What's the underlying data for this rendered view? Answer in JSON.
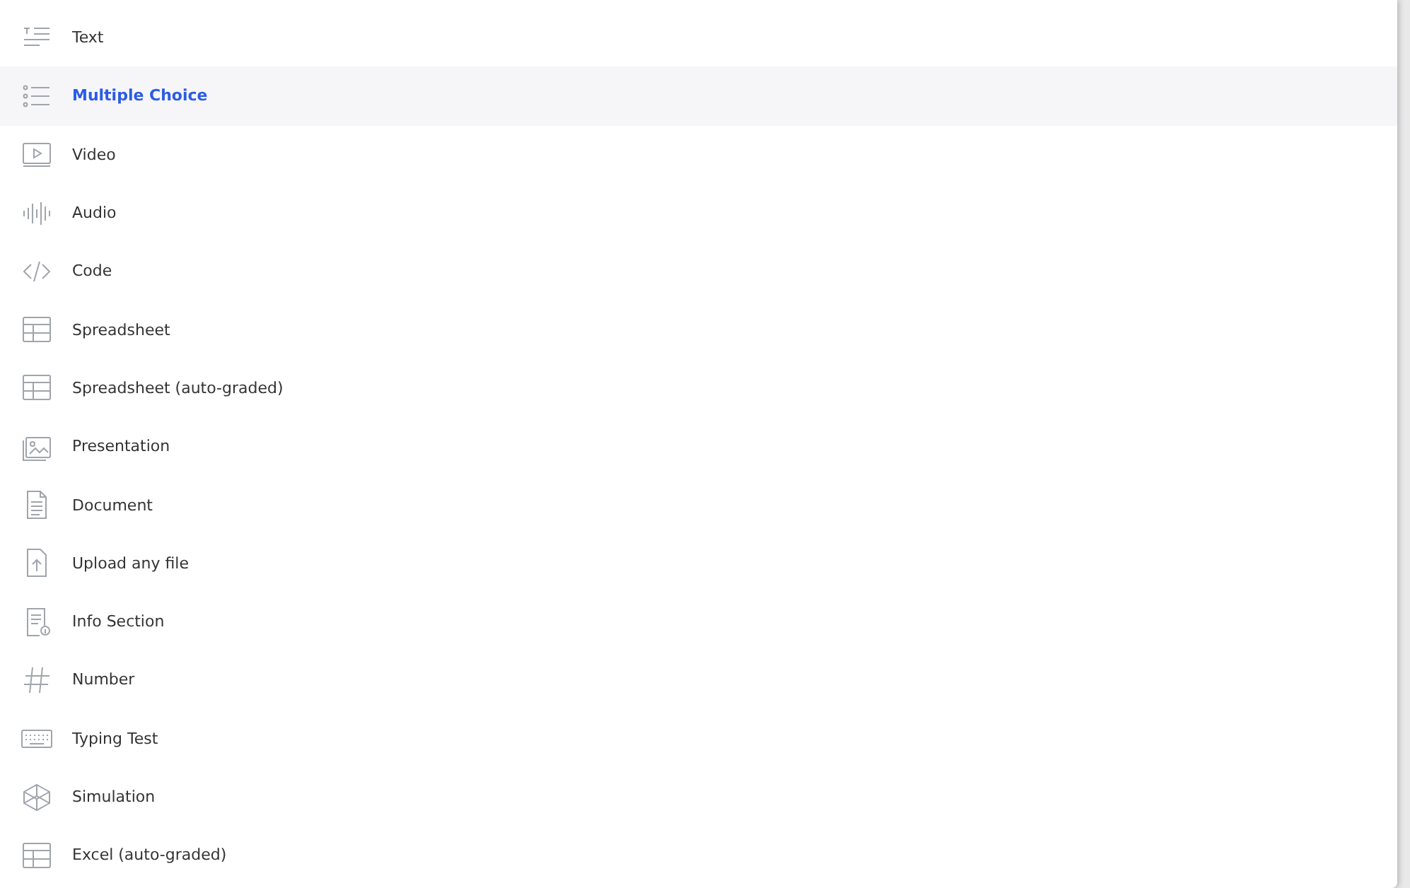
{
  "items": [
    {
      "label": "Text",
      "kind": "text",
      "selected": false
    },
    {
      "label": "Multiple Choice",
      "kind": "choice",
      "selected": true
    },
    {
      "label": "Video",
      "kind": "video",
      "selected": false
    },
    {
      "label": "Audio",
      "kind": "audio",
      "selected": false
    },
    {
      "label": "Code",
      "kind": "code",
      "selected": false
    },
    {
      "label": "Spreadsheet",
      "kind": "table",
      "selected": false
    },
    {
      "label": "Spreadsheet (auto-graded)",
      "kind": "table",
      "selected": false
    },
    {
      "label": "Presentation",
      "kind": "image",
      "selected": false
    },
    {
      "label": "Document",
      "kind": "document",
      "selected": false
    },
    {
      "label": "Upload any file",
      "kind": "upload",
      "selected": false
    },
    {
      "label": "Info Section",
      "kind": "info",
      "selected": false
    },
    {
      "label": "Number",
      "kind": "number",
      "selected": false
    },
    {
      "label": "Typing Test",
      "kind": "keyboard",
      "selected": false
    },
    {
      "label": "Simulation",
      "kind": "cube",
      "selected": false
    },
    {
      "label": "Excel (auto-graded)",
      "kind": "table",
      "selected": false
    }
  ]
}
